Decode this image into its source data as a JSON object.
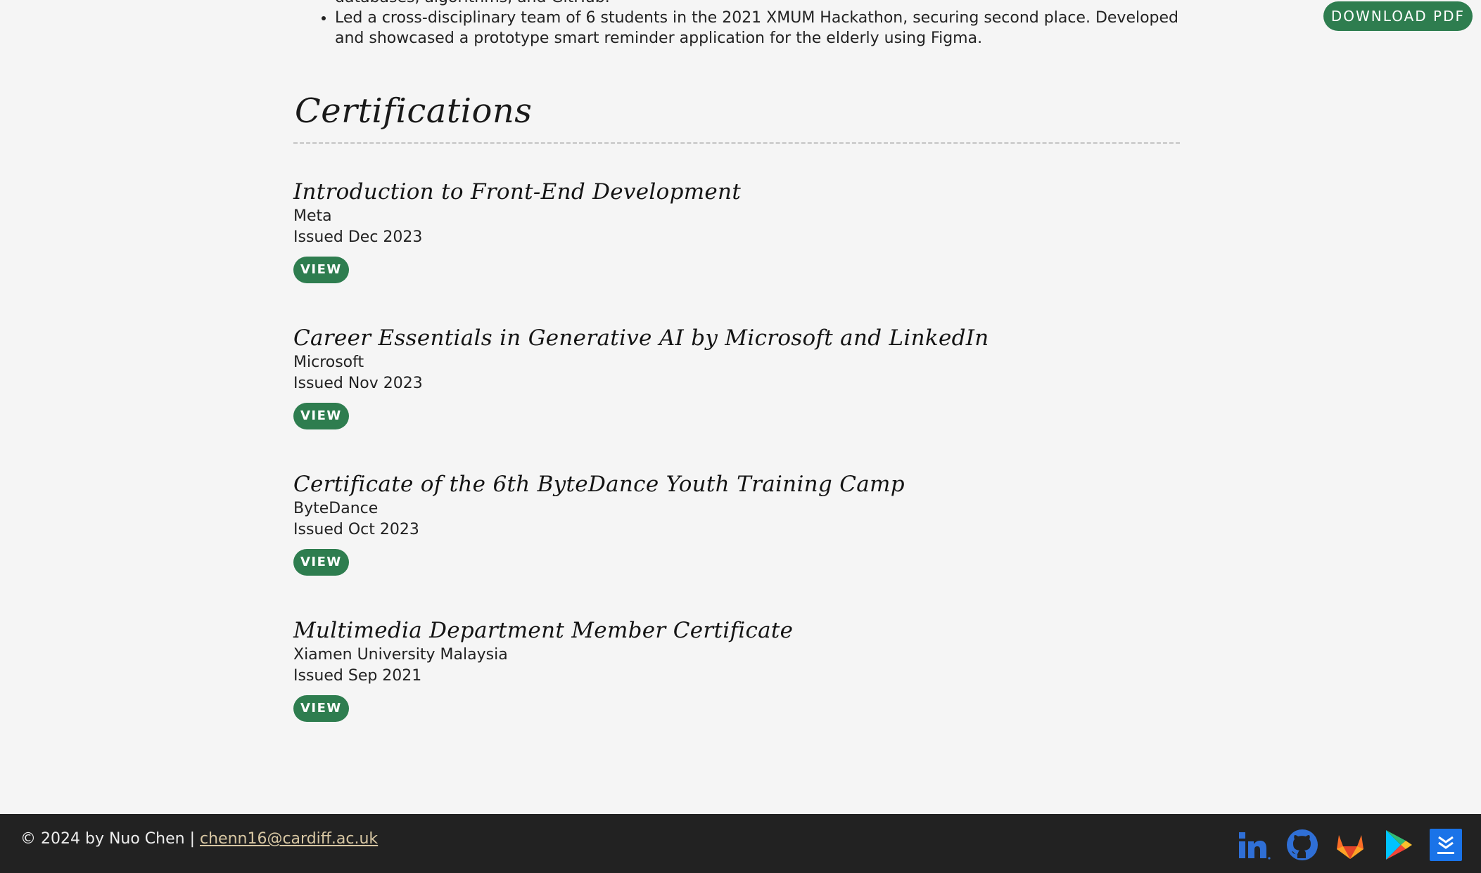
{
  "top_bullets": {
    "partial_line": "databases, algorithms, and GitHub.",
    "item": "Led a cross-disciplinary team of 6 students in the 2021 XMUM Hackathon, securing second place. Developed and showcased a prototype smart reminder application for the elderly using Figma."
  },
  "download_button": {
    "label": "DOWNLOAD PDF"
  },
  "certifications": {
    "title": "Certifications",
    "view_label": "VIEW",
    "items": [
      {
        "title": "Introduction to Front-End Development",
        "issuer": "Meta",
        "issued": "Issued Dec 2023"
      },
      {
        "title": "Career Essentials in Generative AI by Microsoft and LinkedIn",
        "issuer": "Microsoft",
        "issued": "Issued Nov 2023"
      },
      {
        "title": "Certificate of the 6th ByteDance Youth Training Camp",
        "issuer": "ByteDance",
        "issued": "Issued Oct 2023"
      },
      {
        "title": "Multimedia Department Member Certificate",
        "issuer": "Xiamen University Malaysia",
        "issued": "Issued Sep 2021"
      }
    ]
  },
  "footer": {
    "copyright": "© 2024 by Nuo Chen |",
    "email": "chenn16@cardiff.ac.uk",
    "socials": [
      "linkedin-icon",
      "github-icon",
      "gitlab-icon",
      "google-play-icon",
      "download-app-icon"
    ]
  },
  "colors": {
    "accent": "#2e7d4f",
    "background": "#f5f5f5",
    "footer": "#222222",
    "email_link": "#d8c7a3"
  }
}
